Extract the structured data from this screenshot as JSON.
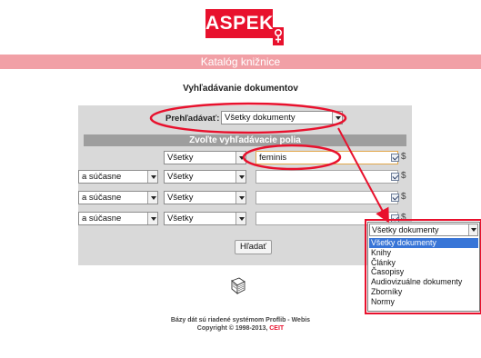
{
  "header": {
    "logo_text": "ASPEKT",
    "banner_title": "Katalóg knižnice"
  },
  "page": {
    "subtitle": "Vyhľadávanie dokumentov"
  },
  "search": {
    "browse_label": "Prehľadávať:",
    "browse_value": "Všetky dokumenty",
    "section_title": "Zvoľte vyhľadávacie polia",
    "rows": [
      {
        "operator": "",
        "field": "Všetky",
        "term": "feminis",
        "checked": true,
        "dollar": "$"
      },
      {
        "operator": "a súčasne",
        "field": "Všetky",
        "term": "",
        "checked": true,
        "dollar": "$"
      },
      {
        "operator": "a súčasne",
        "field": "Všetky",
        "term": "",
        "checked": true,
        "dollar": "$"
      },
      {
        "operator": "a súčasne",
        "field": "Všetky",
        "term": "",
        "checked": true,
        "dollar": "$"
      }
    ],
    "search_button": "Hľadať"
  },
  "dropdown": {
    "selected": "Všetky dokumenty",
    "options": [
      "Všetky dokumenty",
      "Knihy",
      "Články",
      "Časopisy",
      "Audiovizuálne dokumenty",
      "Zborníky",
      "Normy"
    ],
    "highlighted_index": 0
  },
  "footer": {
    "line1": "Bázy dát sú riadené systémom Proflib - Webis",
    "line2_prefix": "Copyright © 1998-2013, ",
    "line2_link": "CEIT"
  },
  "colors": {
    "brand": "#e8112d",
    "banner": "#f1a0a6",
    "panel": "#d9d9d9",
    "annotation": "#e8112d",
    "highlight": "#3875d7"
  },
  "icons": {
    "logo_mark": "gender-symbol-icon",
    "catalog": "book-pen-icon"
  }
}
